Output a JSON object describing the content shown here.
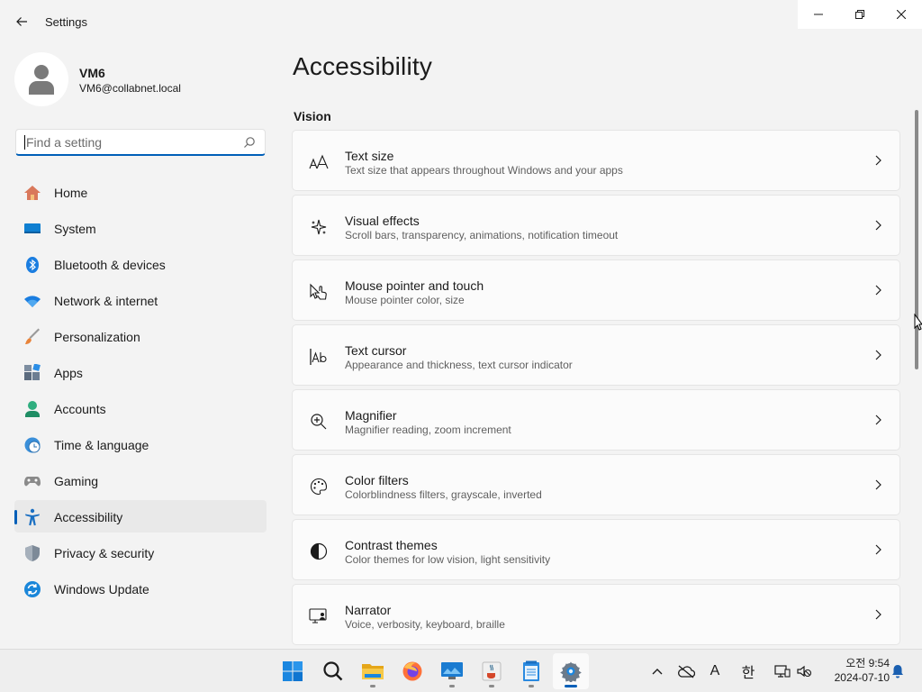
{
  "window": {
    "title": "Settings"
  },
  "profile": {
    "name": "VM6",
    "email": "VM6@collabnet.local"
  },
  "search": {
    "placeholder": "Find a setting"
  },
  "nav": [
    {
      "label": "Home",
      "icon": "home-icon"
    },
    {
      "label": "System",
      "icon": "system-icon"
    },
    {
      "label": "Bluetooth & devices",
      "icon": "bluetooth-icon"
    },
    {
      "label": "Network & internet",
      "icon": "wifi-icon"
    },
    {
      "label": "Personalization",
      "icon": "brush-icon"
    },
    {
      "label": "Apps",
      "icon": "apps-icon"
    },
    {
      "label": "Accounts",
      "icon": "accounts-icon"
    },
    {
      "label": "Time & language",
      "icon": "clock-globe-icon"
    },
    {
      "label": "Gaming",
      "icon": "gamepad-icon"
    },
    {
      "label": "Accessibility",
      "icon": "accessibility-icon",
      "selected": true
    },
    {
      "label": "Privacy & security",
      "icon": "shield-icon"
    },
    {
      "label": "Windows Update",
      "icon": "update-icon"
    }
  ],
  "main": {
    "title": "Accessibility",
    "section": "Vision",
    "cards": [
      {
        "title": "Text size",
        "desc": "Text size that appears throughout Windows and your apps",
        "icon": "text-size-icon"
      },
      {
        "title": "Visual effects",
        "desc": "Scroll bars, transparency, animations, notification timeout",
        "icon": "sparkle-icon"
      },
      {
        "title": "Mouse pointer and touch",
        "desc": "Mouse pointer color, size",
        "icon": "pointer-touch-icon"
      },
      {
        "title": "Text cursor",
        "desc": "Appearance and thickness, text cursor indicator",
        "icon": "text-cursor-icon"
      },
      {
        "title": "Magnifier",
        "desc": "Magnifier reading, zoom increment",
        "icon": "magnifier-icon"
      },
      {
        "title": "Color filters",
        "desc": "Colorblindness filters, grayscale, inverted",
        "icon": "palette-icon"
      },
      {
        "title": "Contrast themes",
        "desc": "Color themes for low vision, light sensitivity",
        "icon": "contrast-icon"
      },
      {
        "title": "Narrator",
        "desc": "Voice, verbosity, keyboard, braille",
        "icon": "narrator-icon"
      }
    ]
  },
  "taskbar": {
    "apps": [
      "start-icon",
      "search-icon",
      "file-explorer-icon",
      "firefox-icon",
      "remote-desktop-icon",
      "java-icon",
      "notepad-icon",
      "settings-icon"
    ],
    "tray": {
      "font_indicator": "A",
      "ime": "한"
    },
    "clock": {
      "time": "오전 9:54",
      "date": "2024-07-10"
    }
  },
  "colors": {
    "accent": "#005fb8",
    "background": "#f3f3f3",
    "card": "#fbfbfb"
  }
}
